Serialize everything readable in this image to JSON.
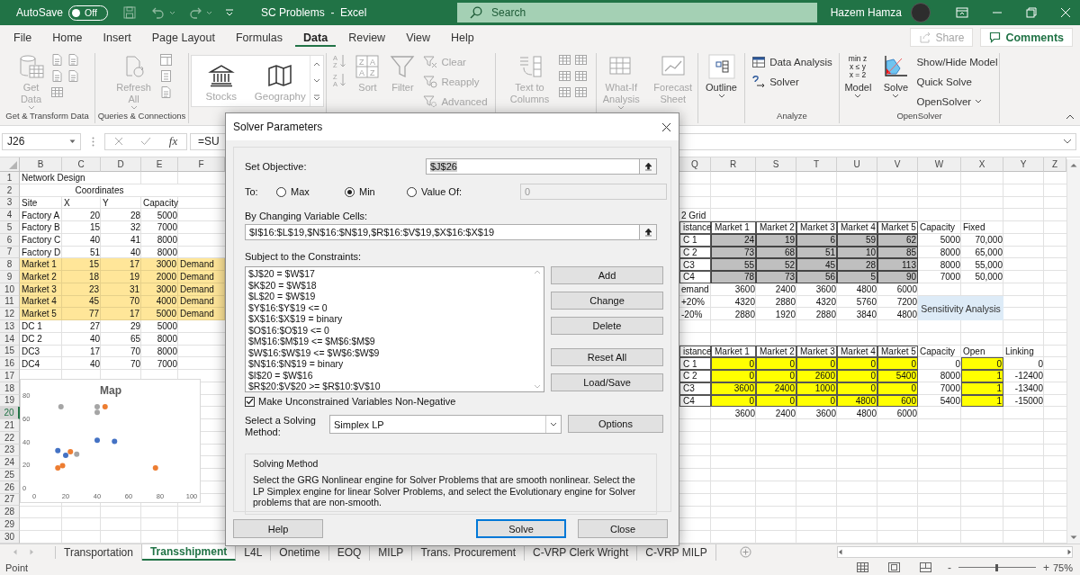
{
  "title_bar": {
    "autosave": {
      "label": "AutoSave",
      "state": "Off",
      "on": false
    },
    "title": "SC Problems  -  Excel",
    "search": {
      "placeholder": "Search"
    },
    "user": "Hazem Hamza"
  },
  "menu": {
    "tabs": [
      {
        "label": "File",
        "selected": false
      },
      {
        "label": "Home",
        "selected": false
      },
      {
        "label": "Insert",
        "selected": false
      },
      {
        "label": "Page Layout",
        "selected": false
      },
      {
        "label": "Formulas",
        "selected": false
      },
      {
        "label": "Data",
        "selected": true
      },
      {
        "label": "Review",
        "selected": false
      },
      {
        "label": "View",
        "selected": false
      },
      {
        "label": "Help",
        "selected": false
      }
    ],
    "share": {
      "label": "Share",
      "disabled": true
    },
    "comments": {
      "label": "Comments"
    }
  },
  "ribbon": {
    "groups": [
      {
        "label": "Get & Transform Data",
        "buttons": [
          {
            "kind": "large",
            "label": "Get Data",
            "menu": true,
            "disabled": true
          },
          {
            "kind": "tool",
            "disabled": true
          },
          {
            "kind": "tool",
            "disabled": true
          },
          {
            "kind": "tool",
            "disabled": true
          },
          {
            "kind": "tool",
            "disabled": true
          },
          {
            "kind": "tool",
            "disabled": true
          }
        ]
      },
      {
        "label": "Queries & Connections",
        "buttons": [
          {
            "kind": "large",
            "label": "Refresh All",
            "menu": true,
            "disabled": true
          },
          {
            "kind": "tool",
            "disabled": true
          },
          {
            "kind": "tool",
            "disabled": true
          },
          {
            "kind": "tool",
            "disabled": true
          }
        ]
      },
      {
        "buttons": [
          {
            "kind": "gallery",
            "label": "Stocks",
            "disabled": true
          },
          {
            "kind": "gallery",
            "label": "Geography",
            "disabled": true
          }
        ]
      },
      {
        "buttons": [
          {
            "kind": "tool",
            "icon_text": [
              "A",
              "Z"
            ],
            "disabled": true
          },
          {
            "kind": "tool",
            "icon_text": [
              "Z",
              "A"
            ],
            "disabled": true
          },
          {
            "kind": "large",
            "label": "Sort",
            "icon_text": [
              "Z",
              "A",
              "A",
              "Z"
            ],
            "disabled": true
          },
          {
            "kind": "large",
            "label": "Filter",
            "disabled": true
          },
          {
            "kind": "small",
            "label": "Clear",
            "disabled": true
          },
          {
            "kind": "small",
            "label": "Reapply",
            "disabled": true
          },
          {
            "kind": "small",
            "label": "Advanced",
            "disabled": true
          }
        ]
      },
      {
        "buttons": [
          {
            "kind": "large",
            "label": "Text to Columns",
            "disabled": true
          },
          {
            "kind": "tool",
            "disabled": true
          },
          {
            "kind": "tool",
            "disabled": true
          },
          {
            "kind": "tool",
            "disabled": true
          },
          {
            "kind": "tool",
            "disabled": true
          },
          {
            "kind": "tool",
            "disabled": true
          },
          {
            "kind": "tool",
            "disabled": true
          }
        ]
      },
      {
        "buttons": [
          {
            "kind": "large",
            "label": "What-If Analysis",
            "menu": true,
            "disabled": true
          },
          {
            "kind": "large",
            "label": "Forecast Sheet",
            "disabled": true
          }
        ]
      },
      {
        "buttons": [
          {
            "kind": "large",
            "label": "Outline",
            "menu": true,
            "disabled": false
          }
        ]
      },
      {
        "label": "Analyze",
        "buttons": [
          {
            "kind": "small",
            "label": "Data Analysis",
            "disabled": false
          },
          {
            "kind": "small",
            "label": "Solver",
            "disabled": false
          }
        ]
      },
      {
        "label": "OpenSolver",
        "buttons": [
          {
            "kind": "large",
            "label": "Model",
            "menu": true,
            "icon_text": [
              "min z",
              "x ≤ y",
              "x = 2"
            ],
            "disabled": false
          },
          {
            "kind": "large",
            "label": "Solve",
            "menu": true,
            "disabled": false
          },
          {
            "kind": "small",
            "label": "Show/Hide Model",
            "disabled": false
          },
          {
            "kind": "small",
            "label": "Quick Solve",
            "disabled": false
          },
          {
            "kind": "small",
            "label": "OpenSolver",
            "menu": true,
            "disabled": false
          }
        ]
      }
    ]
  },
  "formula_bar": {
    "name_box": "J26",
    "fx": "fx",
    "formula": "=SU"
  },
  "sheet": {
    "left_columns": [
      "B",
      "C",
      "D",
      "E",
      "F"
    ],
    "right_columns": [
      "Q",
      "R",
      "S",
      "T",
      "U",
      "V",
      "W",
      "X",
      "Y",
      "Z"
    ],
    "rows": [
      {
        "label": "1",
        "selected": false,
        "highlighted": false,
        "left": [
          {
            "text": "Network Design",
            "kind": "wide"
          }
        ]
      },
      {
        "label": "2",
        "selected": false,
        "highlighted": false,
        "left": [
          {
            "text": "Coordinates",
            "kind": "merged"
          }
        ]
      },
      {
        "label": "3",
        "selected": false,
        "highlighted": false,
        "left": [
          {
            "text": "Site",
            "kind": "text"
          },
          {
            "text": "X",
            "kind": "text"
          },
          {
            "text": "Y",
            "kind": "text"
          },
          {
            "text": "Capacity",
            "kind": "text"
          }
        ]
      },
      {
        "label": "4",
        "selected": false,
        "highlighted": false,
        "left": [
          {
            "text": "Factory A",
            "kind": "text"
          },
          {
            "text": "20",
            "kind": "number"
          },
          {
            "text": "28",
            "kind": "number"
          },
          {
            "text": "5000",
            "kind": "number"
          }
        ],
        "right_label": {
          "text": "2 Grid",
          "kind": "text"
        }
      },
      {
        "label": "5",
        "selected": false,
        "highlighted": false,
        "left": [
          {
            "text": "Factory B",
            "kind": "text"
          },
          {
            "text": "15",
            "kind": "number"
          },
          {
            "text": "32",
            "kind": "number"
          },
          {
            "text": "7000",
            "kind": "number"
          }
        ],
        "right_label": {
          "text": "istance",
          "kind": "boxed"
        },
        "right": [
          {
            "text": "Market 1",
            "kind": "boxed"
          },
          {
            "text": "Market 2",
            "kind": "boxed"
          },
          {
            "text": "Market 3",
            "kind": "boxed"
          },
          {
            "text": "Market 4",
            "kind": "boxed"
          },
          {
            "text": "Market 5",
            "kind": "boxed"
          },
          {
            "text": "Capacity",
            "kind": "text"
          },
          {
            "text": "Fixed",
            "kind": "text"
          }
        ]
      },
      {
        "label": "6",
        "selected": false,
        "highlighted": false,
        "left": [
          {
            "text": "Factory C",
            "kind": "text"
          },
          {
            "text": "40",
            "kind": "number"
          },
          {
            "text": "41",
            "kind": "number"
          },
          {
            "text": "8000",
            "kind": "number"
          }
        ],
        "right_label": {
          "text": "C 1",
          "kind": "boxed"
        },
        "right": [
          {
            "text": "24",
            "kind": "shaded"
          },
          {
            "text": "19",
            "kind": "shaded"
          },
          {
            "text": "6",
            "kind": "shaded"
          },
          {
            "text": "59",
            "kind": "shaded"
          },
          {
            "text": "62",
            "kind": "shaded"
          },
          {
            "text": "5000",
            "kind": "number"
          },
          {
            "text": "70,000",
            "kind": "number"
          }
        ]
      },
      {
        "label": "7",
        "selected": false,
        "highlighted": false,
        "left": [
          {
            "text": "Factory D",
            "kind": "text"
          },
          {
            "text": "51",
            "kind": "number"
          },
          {
            "text": "40",
            "kind": "number"
          },
          {
            "text": "8000",
            "kind": "number"
          }
        ],
        "right_label": {
          "text": "C 2",
          "kind": "boxed"
        },
        "right": [
          {
            "text": "73",
            "kind": "shaded"
          },
          {
            "text": "68",
            "kind": "shaded"
          },
          {
            "text": "51",
            "kind": "shaded"
          },
          {
            "text": "10",
            "kind": "shaded"
          },
          {
            "text": "85",
            "kind": "shaded"
          },
          {
            "text": "8000",
            "kind": "number"
          },
          {
            "text": "65,000",
            "kind": "number"
          }
        ]
      },
      {
        "label": "8",
        "selected": false,
        "highlighted": true,
        "left": [
          {
            "text": "Market 1",
            "kind": "text"
          },
          {
            "text": "15",
            "kind": "number"
          },
          {
            "text": "17",
            "kind": "number"
          },
          {
            "text": "3000",
            "kind": "number"
          },
          {
            "text": "Demand",
            "kind": "text"
          }
        ],
        "right_label": {
          "text": "C3",
          "kind": "boxed"
        },
        "right": [
          {
            "text": "55",
            "kind": "shaded"
          },
          {
            "text": "52",
            "kind": "shaded"
          },
          {
            "text": "45",
            "kind": "shaded"
          },
          {
            "text": "28",
            "kind": "shaded"
          },
          {
            "text": "113",
            "kind": "shaded"
          },
          {
            "text": "8000",
            "kind": "number"
          },
          {
            "text": "55,000",
            "kind": "number"
          }
        ]
      },
      {
        "label": "9",
        "selected": false,
        "highlighted": true,
        "left": [
          {
            "text": "Market 2",
            "kind": "text"
          },
          {
            "text": "18",
            "kind": "number"
          },
          {
            "text": "19",
            "kind": "number"
          },
          {
            "text": "2000",
            "kind": "number"
          },
          {
            "text": "Demand",
            "kind": "text"
          }
        ],
        "right_label": {
          "text": "C4",
          "kind": "boxed"
        },
        "right": [
          {
            "text": "78",
            "kind": "shaded"
          },
          {
            "text": "73",
            "kind": "shaded"
          },
          {
            "text": "56",
            "kind": "shaded"
          },
          {
            "text": "5",
            "kind": "shaded"
          },
          {
            "text": "90",
            "kind": "shaded"
          },
          {
            "text": "7000",
            "kind": "number"
          },
          {
            "text": "50,000",
            "kind": "number"
          }
        ]
      },
      {
        "label": "10",
        "selected": false,
        "highlighted": true,
        "left": [
          {
            "text": "Market 3",
            "kind": "text"
          },
          {
            "text": "23",
            "kind": "number"
          },
          {
            "text": "31",
            "kind": "number"
          },
          {
            "text": "3000",
            "kind": "number"
          },
          {
            "text": "Demand",
            "kind": "text"
          }
        ],
        "right_label": {
          "text": "emand",
          "kind": "text"
        },
        "right": [
          {
            "text": "3600",
            "kind": "number"
          },
          {
            "text": "2400",
            "kind": "number"
          },
          {
            "text": "3600",
            "kind": "number"
          },
          {
            "text": "4800",
            "kind": "number"
          },
          {
            "text": "6000",
            "kind": "number"
          }
        ]
      },
      {
        "label": "11",
        "selected": false,
        "highlighted": true,
        "left": [
          {
            "text": "Market 4",
            "kind": "text"
          },
          {
            "text": "45",
            "kind": "number"
          },
          {
            "text": "70",
            "kind": "number"
          },
          {
            "text": "4000",
            "kind": "number"
          },
          {
            "text": "Demand",
            "kind": "text"
          }
        ],
        "right_label": {
          "text": "+20%",
          "kind": "text"
        },
        "right": [
          {
            "text": "4320",
            "kind": "number"
          },
          {
            "text": "2880",
            "kind": "number"
          },
          {
            "text": "4320",
            "kind": "number"
          },
          {
            "text": "5760",
            "kind": "number"
          },
          {
            "text": "7200",
            "kind": "number"
          }
        ]
      },
      {
        "label": "12",
        "selected": false,
        "highlighted": true,
        "left": [
          {
            "text": "Market 5",
            "kind": "text"
          },
          {
            "text": "77",
            "kind": "number"
          },
          {
            "text": "17",
            "kind": "number"
          },
          {
            "text": "5000",
            "kind": "number"
          },
          {
            "text": "Demand",
            "kind": "text"
          }
        ],
        "right_label": {
          "text": "-20%",
          "kind": "text"
        },
        "right": [
          {
            "text": "2880",
            "kind": "number"
          },
          {
            "text": "1920",
            "kind": "number"
          },
          {
            "text": "2880",
            "kind": "number"
          },
          {
            "text": "3840",
            "kind": "number"
          },
          {
            "text": "4800",
            "kind": "number"
          }
        ]
      },
      {
        "label": "13",
        "selected": false,
        "highlighted": false,
        "left": [
          {
            "text": "DC 1",
            "kind": "text"
          },
          {
            "text": "27",
            "kind": "number"
          },
          {
            "text": "29",
            "kind": "number"
          },
          {
            "text": "5000",
            "kind": "number"
          }
        ]
      },
      {
        "label": "14",
        "selected": false,
        "highlighted": false,
        "left": [
          {
            "text": "DC 2",
            "kind": "text"
          },
          {
            "text": "40",
            "kind": "number"
          },
          {
            "text": "65",
            "kind": "number"
          },
          {
            "text": "8000",
            "kind": "number"
          }
        ]
      },
      {
        "label": "15",
        "selected": false,
        "highlighted": false,
        "left": [
          {
            "text": "DC3",
            "kind": "text"
          },
          {
            "text": "17",
            "kind": "number"
          },
          {
            "text": "70",
            "kind": "number"
          },
          {
            "text": "8000",
            "kind": "number"
          }
        ],
        "right_label": {
          "text": "istance",
          "kind": "boxed"
        },
        "right": [
          {
            "text": "Market 1",
            "kind": "boxed"
          },
          {
            "text": "Market 2",
            "kind": "boxed"
          },
          {
            "text": "Market 3",
            "kind": "boxed"
          },
          {
            "text": "Market 4",
            "kind": "boxed"
          },
          {
            "text": "Market 5",
            "kind": "boxed"
          },
          {
            "text": "Capacity",
            "kind": "text"
          },
          {
            "text": "Open",
            "kind": "text"
          },
          {
            "text": "Linking",
            "kind": "text"
          }
        ]
      },
      {
        "label": "16",
        "selected": false,
        "highlighted": false,
        "left": [
          {
            "text": "DC4",
            "kind": "text"
          },
          {
            "text": "40",
            "kind": "number"
          },
          {
            "text": "70",
            "kind": "number"
          },
          {
            "text": "7000",
            "kind": "number"
          }
        ],
        "right_label": {
          "text": "C 1",
          "kind": "boxed"
        },
        "right": [
          {
            "text": "0",
            "kind": "input"
          },
          {
            "text": "0",
            "kind": "input"
          },
          {
            "text": "0",
            "kind": "input"
          },
          {
            "text": "0",
            "kind": "input"
          },
          {
            "text": "0",
            "kind": "input"
          },
          {
            "text": "0",
            "kind": "number"
          },
          {
            "text": "0",
            "kind": "input"
          },
          {
            "text": "0",
            "kind": "number"
          }
        ]
      },
      {
        "label": "17",
        "selected": false,
        "highlighted": false,
        "right_label": {
          "text": "C 2",
          "kind": "boxed"
        },
        "right": [
          {
            "text": "0",
            "kind": "input"
          },
          {
            "text": "0",
            "kind": "input"
          },
          {
            "text": "2600",
            "kind": "input"
          },
          {
            "text": "0",
            "kind": "input"
          },
          {
            "text": "5400",
            "kind": "input"
          },
          {
            "text": "8000",
            "kind": "number"
          },
          {
            "text": "1",
            "kind": "input"
          },
          {
            "text": "-12400",
            "kind": "number"
          }
        ]
      },
      {
        "label": "18",
        "selected": false,
        "highlighted": false,
        "right_label": {
          "text": "C3",
          "kind": "boxed"
        },
        "right": [
          {
            "text": "3600",
            "kind": "input"
          },
          {
            "text": "2400",
            "kind": "input"
          },
          {
            "text": "1000",
            "kind": "input"
          },
          {
            "text": "0",
            "kind": "input"
          },
          {
            "text": "0",
            "kind": "input"
          },
          {
            "text": "7000",
            "kind": "number"
          },
          {
            "text": "1",
            "kind": "input"
          },
          {
            "text": "-13400",
            "kind": "number"
          }
        ]
      },
      {
        "label": "19",
        "selected": false,
        "highlighted": false,
        "right_label": {
          "text": "C4",
          "kind": "boxed"
        },
        "right": [
          {
            "text": "0",
            "kind": "input"
          },
          {
            "text": "0",
            "kind": "input"
          },
          {
            "text": "0",
            "kind": "input"
          },
          {
            "text": "4800",
            "kind": "input"
          },
          {
            "text": "600",
            "kind": "input"
          },
          {
            "text": "5400",
            "kind": "number"
          },
          {
            "text": "1",
            "kind": "input"
          },
          {
            "text": "-15000",
            "kind": "number"
          }
        ]
      },
      {
        "label": "20",
        "selected": true,
        "highlighted": false,
        "right": [
          {
            "text": "3600",
            "kind": "number"
          },
          {
            "text": "2400",
            "kind": "number"
          },
          {
            "text": "3600",
            "kind": "number"
          },
          {
            "text": "4800",
            "kind": "number"
          },
          {
            "text": "6000",
            "kind": "number"
          }
        ]
      },
      {
        "label": "21",
        "selected": false,
        "highlighted": false
      },
      {
        "label": "22",
        "selected": false,
        "highlighted": false
      },
      {
        "label": "23",
        "selected": false,
        "highlighted": false
      },
      {
        "label": "24",
        "selected": false,
        "highlighted": false
      },
      {
        "label": "25",
        "selected": false,
        "highlighted": false
      },
      {
        "label": "26",
        "selected": false,
        "highlighted": false
      },
      {
        "label": "27",
        "selected": false,
        "highlighted": false
      },
      {
        "label": "28",
        "selected": false,
        "highlighted": false
      },
      {
        "label": "29",
        "selected": false,
        "highlighted": false
      },
      {
        "label": "30",
        "selected": false,
        "highlighted": false
      }
    ],
    "sheet_button": {
      "label": "Sensitivity Analysis"
    },
    "chart": {
      "chart_data": {
        "type": "scatter",
        "title": "Map",
        "xlim": [
          0,
          100
        ],
        "ylim": [
          0,
          80
        ],
        "xticks": [
          0,
          20,
          40,
          60,
          80,
          100
        ],
        "yticks": [
          0,
          20,
          40,
          60,
          80
        ],
        "series": [
          {
            "color": "#4472c4",
            "x": [
              20,
              15,
              40,
              51
            ],
            "values": [
              28,
              32,
              41,
              40
            ]
          },
          {
            "color": "#ed7d31",
            "x": [
              15,
              18,
              23,
              45,
              77
            ],
            "values": [
              17,
              19,
              31,
              70,
              17
            ]
          },
          {
            "color": "#a5a5a5",
            "x": [
              27,
              40,
              17,
              40
            ],
            "values": [
              29,
              65,
              70,
              70
            ]
          }
        ]
      }
    }
  },
  "dialog": {
    "title": "Solver Parameters",
    "objective": {
      "label": "Set Objective:",
      "value": "$J$26",
      "highlighted": true
    },
    "to": {
      "label": "To:",
      "options": [
        {
          "label": "Max",
          "selected": false
        },
        {
          "label": "Min",
          "selected": true
        },
        {
          "label": "Value Of:",
          "selected": false
        }
      ],
      "value_field": {
        "value": "0",
        "disabled": true
      }
    },
    "variables": {
      "label": "By Changing Variable Cells:",
      "value": "$I$16:$L$19,$N$16:$N$19,$R$16:$V$19,$X$16:$X$19"
    },
    "constraints": {
      "label": "Subject to the Constraints:",
      "items": [
        "$J$20 = $W$17",
        "$K$20 = $W$18",
        "$L$20 = $W$19",
        "$Y$16:$Y$19 <= 0",
        "$X$16:$X$19 = binary",
        "$O$16:$O$19 <= 0",
        "$M$16:$M$19 <= $M$6:$M$9",
        "$W$16:$W$19 <= $W$6:$W$9",
        "$N$16:$N$19 = binary",
        "$I$20 = $W$16",
        "$R$20:$V$20 >= $R$10:$V$10"
      ]
    },
    "side_buttons": [
      "Add",
      "Change",
      "Delete",
      "Reset All",
      "Load/Save"
    ],
    "non_negative": {
      "label": "Make Unconstrained Variables Non-Negative",
      "checked": true
    },
    "method": {
      "label": "Select a Solving Method:",
      "value": "Simplex LP",
      "options_button": "Options"
    },
    "description": {
      "title": "Solving Method",
      "text": "Select the GRG Nonlinear engine for Solver Problems that are smooth nonlinear. Select the LP Simplex engine for linear Solver Problems, and select the Evolutionary engine for Solver problems that are non-smooth."
    },
    "buttons": [
      {
        "label": "Help",
        "default": false
      },
      {
        "label": "Solve",
        "default": true
      },
      {
        "label": "Close",
        "default": false
      }
    ]
  },
  "sheet_tabs": {
    "tabs": [
      {
        "label": "Transportation",
        "selected": false
      },
      {
        "label": "Transshipment",
        "selected": true
      },
      {
        "label": "L4L",
        "selected": false
      },
      {
        "label": "Onetime",
        "selected": false
      },
      {
        "label": "EOQ",
        "selected": false
      },
      {
        "label": "MILP",
        "selected": false
      },
      {
        "label": "Trans. Procurement",
        "selected": false
      },
      {
        "label": "C-VRP Clerk Wright",
        "selected": false
      },
      {
        "label": "C-VRP MILP",
        "selected": false
      }
    ]
  },
  "status_bar": {
    "text": "Point",
    "zoom": {
      "minus": "-",
      "plus": "+",
      "level": 0.5,
      "reading": "75%"
    }
  }
}
